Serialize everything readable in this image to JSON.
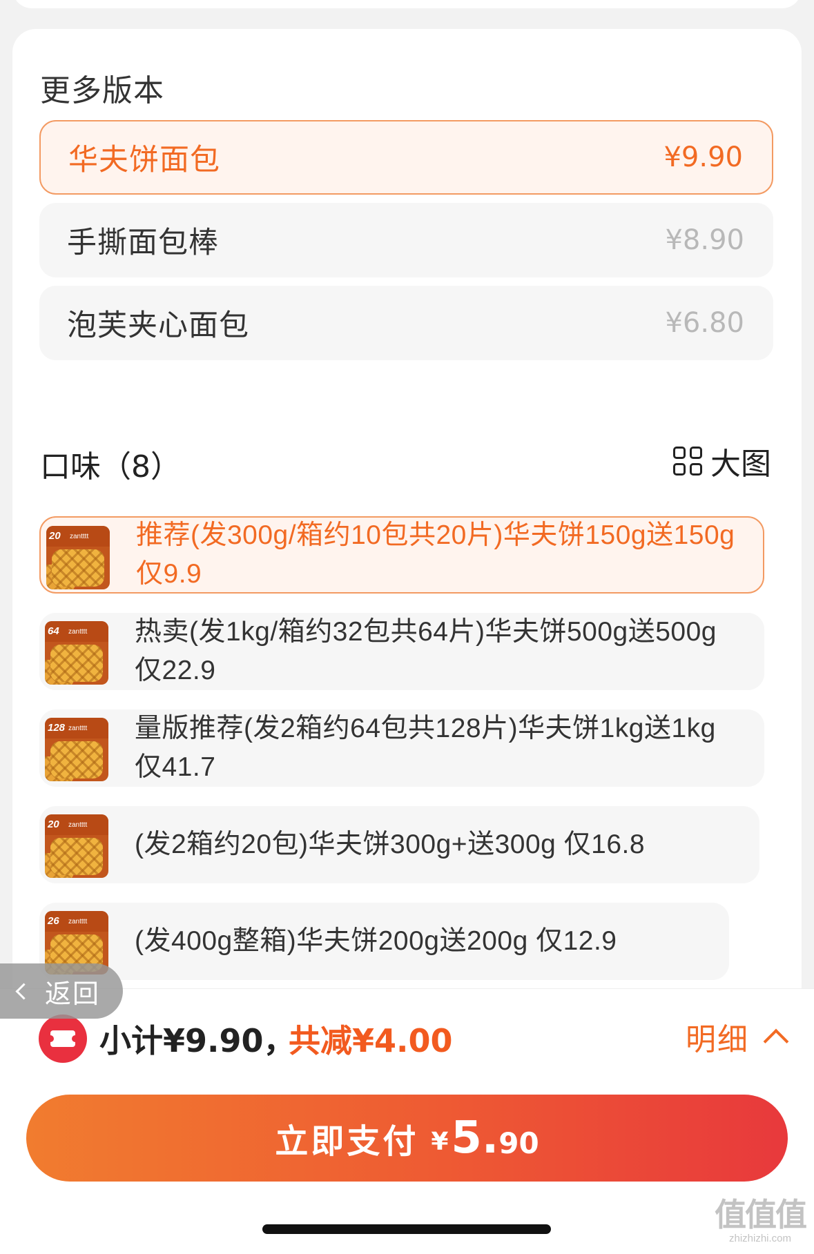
{
  "section_title": "更多版本",
  "versions": [
    {
      "name": "华夫饼面包",
      "price": "¥9.90",
      "selected": true
    },
    {
      "name": "手撕面包棒",
      "price": "¥8.90",
      "selected": false
    },
    {
      "name": "泡芙夹心面包",
      "price": "¥6.80",
      "selected": false
    }
  ],
  "flavors_title": "口味（8）",
  "big_picture_label": "大图",
  "flavors": [
    {
      "text": "推荐(发300g/箱约10包共20片)华夫饼150g送150g 仅9.9",
      "badge": "20",
      "selected": true
    },
    {
      "text": "热卖(发1kg/箱约32包共64片)华夫饼500g送500g 仅22.9",
      "badge": "64",
      "selected": false
    },
    {
      "text": "量版推荐(发2箱约64包共128片)华夫饼1kg送1kg 仅41.7",
      "badge": "128",
      "selected": false
    },
    {
      "text": "(发2箱约20包)华夫饼300g+送300g 仅16.8",
      "badge": "20",
      "selected": false
    },
    {
      "text": "(发400g整箱)华夫饼200g送200g 仅12.9",
      "badge": "26",
      "selected": false
    }
  ],
  "thumb_brand": "zantttt",
  "back_label": "返回",
  "summary": {
    "subtotal": "小计¥9.90，",
    "discount": "共减¥4.00",
    "detail_label": "明细"
  },
  "pay": {
    "label": "立即支付",
    "currency": "¥",
    "amount_int": "5.",
    "amount_dec": "90"
  },
  "watermark": {
    "main": "值值值",
    "sub": "zhizhizhi.com"
  },
  "colors": {
    "accent": "#f26a23",
    "selected_bg": "#fff4ee",
    "selected_border": "#f39a62",
    "pay_gradient_start": "#f17c2f",
    "pay_gradient_end": "#e8393c",
    "coupon_red": "#e9303f"
  }
}
